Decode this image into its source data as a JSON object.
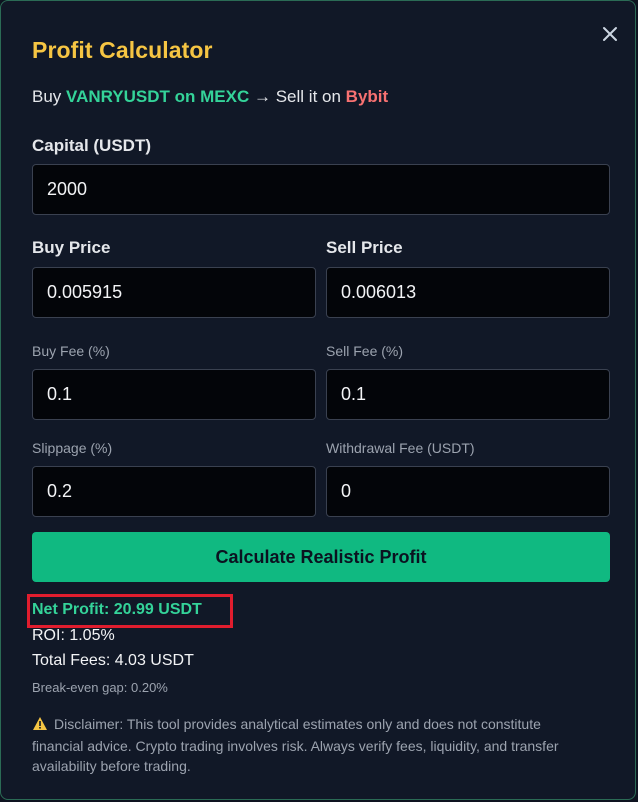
{
  "modal": {
    "title": "Profit Calculator",
    "close_icon": "close-icon"
  },
  "route": {
    "prefix": "Buy",
    "buy_pair": "VANRYUSDT on MEXC",
    "middle": "→ Sell it on",
    "sell_exchange": "Bybit"
  },
  "form": {
    "capital": {
      "label": "Capital (USDT)",
      "value": "2000"
    },
    "buy_price": {
      "label": "Buy Price",
      "value": "0.005915"
    },
    "sell_price": {
      "label": "Sell Price",
      "value": "0.006013"
    },
    "buy_fee": {
      "label": "Buy Fee (%)",
      "value": "0.1"
    },
    "sell_fee": {
      "label": "Sell Fee (%)",
      "value": "0.1"
    },
    "slippage": {
      "label": "Slippage (%)",
      "value": "0.2"
    },
    "withdrawal_fee": {
      "label": "Withdrawal Fee (USDT)",
      "value": "0"
    },
    "submit_label": "Calculate Realistic Profit"
  },
  "results": {
    "net_profit": "Net Profit: 20.99 USDT",
    "roi": "ROI: 1.05%",
    "total_fees": "Total Fees: 4.03 USDT",
    "break_even": "Break-even gap: 0.20%"
  },
  "disclaimer": {
    "icon": "warning-icon",
    "text": "Disclaimer: This tool provides analytical estimates only and does not constitute financial advice. Crypto trading involves risk. Always verify fees, liquidity, and transfer availability before trading."
  },
  "colors": {
    "title": "#f6c543",
    "buy_highlight": "#34d399",
    "sell_highlight": "#f87171",
    "button": "#10b981",
    "annotation_box": "#e11d2e",
    "background": "#111827"
  }
}
